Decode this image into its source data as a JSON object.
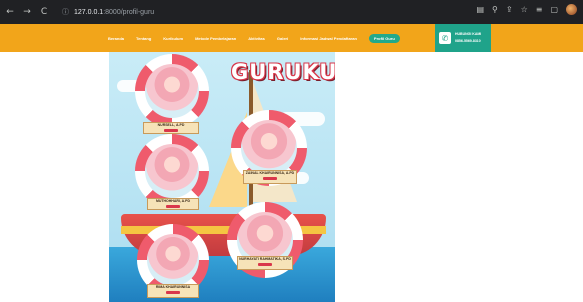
{
  "browser": {
    "back_glyph": "←",
    "forward_glyph": "→",
    "reload_glyph": "C",
    "info_glyph": "ⓘ",
    "url_host": "127.0.0.1",
    "url_path": ":8000/profil-guru",
    "toolbar_icons": [
      "translate-icon",
      "search-icon",
      "share-icon",
      "star-icon",
      "extensions-icon",
      "window-icon",
      "profile-icon"
    ],
    "toolbar_glyphs": [
      "▤",
      "⚲",
      "⇪",
      "☆",
      "≡",
      "▢"
    ]
  },
  "site": {
    "menu": [
      {
        "label": "Beranda"
      },
      {
        "label": "Tentang"
      },
      {
        "label": "Kurikulum"
      },
      {
        "label": "Metode Pembelajaran"
      },
      {
        "label": "Aktivitas"
      },
      {
        "label": "Galeri"
      },
      {
        "label": "Informasi Jadwal Pendaftaran"
      },
      {
        "label": "Profil Guru"
      }
    ],
    "contact": {
      "phone_glyph": "✆",
      "title": "HUBUNGI KAMI",
      "number": "0856-5569-8310"
    },
    "colors": {
      "bar": "#f2a51a",
      "active_tab": "#23a98a",
      "contact_bg": "#1fa38a"
    }
  },
  "poster": {
    "logo": "GURUKU",
    "teachers": [
      {
        "name": "NURSELL, A.PD"
      },
      {
        "name": "ZAINAL KHAIRUNNISA, A.PD"
      },
      {
        "name": "MUTHOHHARI, A.PD"
      },
      {
        "name": "NURHAYATI RAHMATIKA, S.PD"
      },
      {
        "name": "RIMA KHAIRUNNISA"
      }
    ]
  }
}
